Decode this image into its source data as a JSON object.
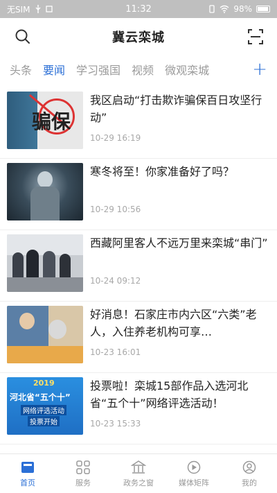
{
  "status_bar": {
    "carrier": "无SIM",
    "time": "11:32",
    "battery": "98%",
    "battery_level": 0.98
  },
  "header": {
    "title": "冀云栾城",
    "search_icon": "search-icon",
    "scan_icon": "scan-icon"
  },
  "tabs": [
    {
      "label": "头条",
      "active": false
    },
    {
      "label": "要闻",
      "active": true
    },
    {
      "label": "学习强国",
      "active": false
    },
    {
      "label": "视频",
      "active": false
    },
    {
      "label": "微观栾城",
      "active": false
    }
  ],
  "tabs_add": "+",
  "news": [
    {
      "title": "我区启动“打击欺诈骗保百日攻坚行动”",
      "time": "10-29 16:19",
      "thumb_text": "骗保"
    },
    {
      "title": "寒冬将至！你家准备好了吗？",
      "time": "10-29 10:56"
    },
    {
      "title": "西藏阿里客人不远万里来栾城“串门”",
      "time": "10-24 09:12"
    },
    {
      "title": "好消息！石家庄市内六区“六类”老人，入住养老机构可享…",
      "time": "10-23 16:01"
    },
    {
      "title": "投票啦！栾城15部作品入选河北省“五个十”网络评选活动！",
      "time": "10-23 15:33",
      "thumb_year": "2019",
      "thumb_line1": "河北省“五个十”",
      "thumb_line2": "网络评选活动",
      "thumb_line3": "投票开始"
    }
  ],
  "bottom_nav": [
    {
      "label": "首页",
      "icon": "home-icon",
      "active": true
    },
    {
      "label": "服务",
      "icon": "grid-icon",
      "active": false
    },
    {
      "label": "政务之窗",
      "icon": "building-icon",
      "active": false
    },
    {
      "label": "媒体矩阵",
      "icon": "media-icon",
      "active": false
    },
    {
      "label": "我的",
      "icon": "user-icon",
      "active": false
    }
  ],
  "colors": {
    "accent": "#2b6fd6",
    "status_bar": "#bfbfbf"
  }
}
